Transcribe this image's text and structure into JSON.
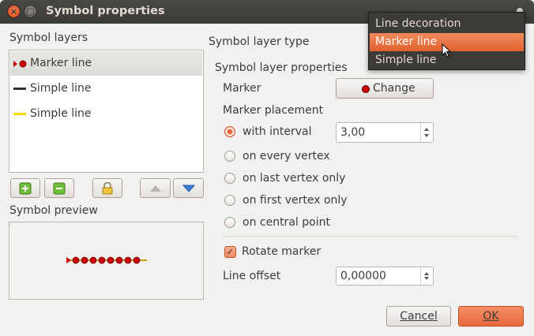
{
  "window": {
    "title": "Symbol properties",
    "close_glyph": "×",
    "max_glyph": "□"
  },
  "symbol_layers": {
    "heading": "Symbol layers",
    "items": [
      {
        "label": "Marker line",
        "icon": "marker-line-icon",
        "selected": true
      },
      {
        "label": "Simple line",
        "icon": "simple-line-dark-icon",
        "color": "#2e3436"
      },
      {
        "label": "Simple line",
        "icon": "simple-line-yellow-icon",
        "color": "#f5d900"
      }
    ]
  },
  "symbol_preview": {
    "heading": "Symbol preview",
    "marker_color": "#cc0000",
    "line_color": "#c4a000",
    "marker_count": 8
  },
  "layer_type": {
    "label": "Symbol layer type",
    "options": [
      "Line decoration",
      "Marker line",
      "Simple line"
    ],
    "highlighted": "Marker line"
  },
  "properties": {
    "heading": "Symbol layer properties",
    "marker_label": "Marker",
    "change_button": "Change",
    "placement_label": "Marker placement",
    "placements": [
      {
        "label": "with interval",
        "checked": true
      },
      {
        "label": "on every vertex",
        "checked": false
      },
      {
        "label": "on last vertex only",
        "checked": false
      },
      {
        "label": "on first vertex only",
        "checked": false
      },
      {
        "label": "on central point",
        "checked": false
      }
    ],
    "interval_value": "3,00",
    "rotate_label": "Rotate marker",
    "rotate_checked": true,
    "offset_label": "Line offset",
    "offset_value": "0,00000"
  },
  "buttons": {
    "cancel": "Cancel",
    "ok": "OK"
  },
  "colors": {
    "accent": "#e9643a",
    "titlebar": "#3c3b37"
  }
}
